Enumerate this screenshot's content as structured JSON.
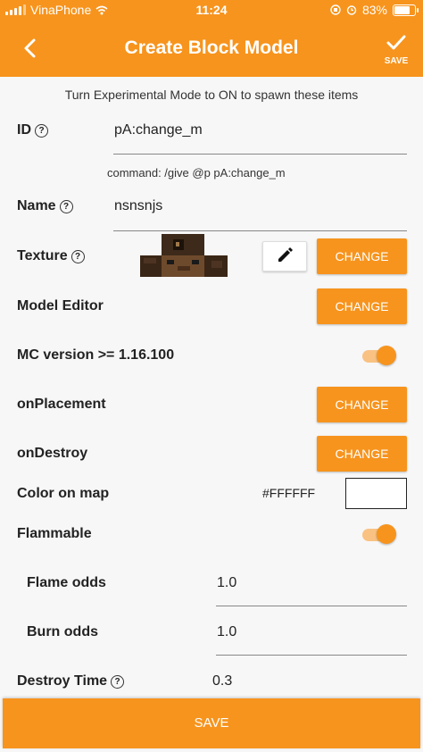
{
  "status_bar": {
    "carrier": "VinaPhone",
    "time": "11:24",
    "battery": "83%"
  },
  "app_bar": {
    "title": "Create Block Model",
    "save_label": "SAVE"
  },
  "notice": "Turn Experimental Mode to ON to spawn these items",
  "id_field": {
    "label": "ID",
    "value": "pA:change_m"
  },
  "command": "command: /give @p pA:change_m",
  "name_field": {
    "label": "Name",
    "value": "nsnsnjs"
  },
  "texture": {
    "label": "Texture",
    "button": "CHANGE"
  },
  "model_editor": {
    "label": "Model Editor",
    "button": "CHANGE"
  },
  "mc_version": {
    "label": "MC version >= 1.16.100",
    "enabled": true
  },
  "on_placement": {
    "label": "onPlacement",
    "button": "CHANGE"
  },
  "on_destroy": {
    "label": "onDestroy",
    "button": "CHANGE"
  },
  "color_on_map": {
    "label": "Color on map",
    "value": "#FFFFFF",
    "swatch_color": "#FFFFFF"
  },
  "flammable": {
    "label": "Flammable",
    "enabled": true
  },
  "flame_odds": {
    "label": "Flame odds",
    "value": "1.0"
  },
  "burn_odds": {
    "label": "Burn odds",
    "value": "1.0"
  },
  "destroy_time": {
    "label": "Destroy Time",
    "value": "0.3"
  },
  "bottom_save": "SAVE",
  "colors": {
    "accent": "#f7941d",
    "toggle_track": "#f9c283",
    "background": "#f7f7f7"
  }
}
